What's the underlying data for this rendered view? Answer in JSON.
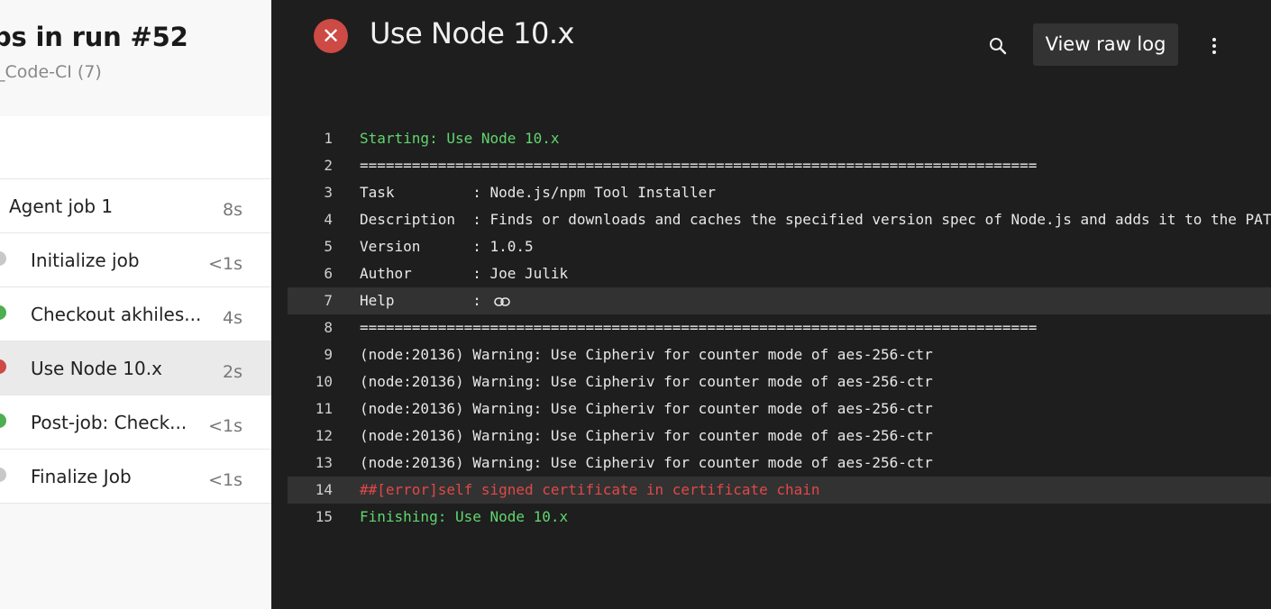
{
  "sidebar": {
    "title": "bs in run #52",
    "subtitle": "_Code-CI (7)",
    "jobs": [
      {
        "label": "Agent job 1",
        "duration": "8s",
        "status": "none"
      },
      {
        "label": "Initialize job",
        "duration": "<1s",
        "status": "skipped"
      },
      {
        "label": "Checkout akhiles...",
        "duration": "4s",
        "status": "success"
      },
      {
        "label": "Use Node 10.x",
        "duration": "2s",
        "status": "failed"
      },
      {
        "label": "Post-job: Check...",
        "duration": "<1s",
        "status": "success"
      },
      {
        "label": "Finalize Job",
        "duration": "<1s",
        "status": "skipped"
      }
    ]
  },
  "header": {
    "title": "Use Node 10.x",
    "raw_log_label": "View raw log",
    "status_icon": "error-x-icon"
  },
  "colors": {
    "success": "#4caf50",
    "failed": "#cd4a45",
    "skipped": "#c8c8c8",
    "log_green": "#60d66f",
    "log_red": "#e04848"
  },
  "log": {
    "lines": [
      {
        "n": "1",
        "text": "Starting: Use Node 10.x",
        "style": "green"
      },
      {
        "n": "2",
        "text": "==============================================================================",
        "style": ""
      },
      {
        "n": "3",
        "text": "Task         : Node.js/npm Tool Installer",
        "style": ""
      },
      {
        "n": "4",
        "text": "Description  : Finds or downloads and caches the specified version spec of Node.js and adds it to the PATH",
        "style": ""
      },
      {
        "n": "5",
        "text": "Version      : 1.0.5",
        "style": ""
      },
      {
        "n": "6",
        "text": "Author       : Joe Julik",
        "style": ""
      },
      {
        "n": "7",
        "text": "Help         :",
        "style": "",
        "link": true,
        "highlight": true
      },
      {
        "n": "8",
        "text": "==============================================================================",
        "style": ""
      },
      {
        "n": "9",
        "text": "(node:20136) Warning: Use Cipheriv for counter mode of aes-256-ctr",
        "style": ""
      },
      {
        "n": "10",
        "text": "(node:20136) Warning: Use Cipheriv for counter mode of aes-256-ctr",
        "style": ""
      },
      {
        "n": "11",
        "text": "(node:20136) Warning: Use Cipheriv for counter mode of aes-256-ctr",
        "style": ""
      },
      {
        "n": "12",
        "text": "(node:20136) Warning: Use Cipheriv for counter mode of aes-256-ctr",
        "style": ""
      },
      {
        "n": "13",
        "text": "(node:20136) Warning: Use Cipheriv for counter mode of aes-256-ctr",
        "style": ""
      },
      {
        "n": "14",
        "text": "##[error]self signed certificate in certificate chain",
        "style": "red",
        "highlight": true
      },
      {
        "n": "15",
        "text": "Finishing: Use Node 10.x",
        "style": "green"
      }
    ]
  }
}
